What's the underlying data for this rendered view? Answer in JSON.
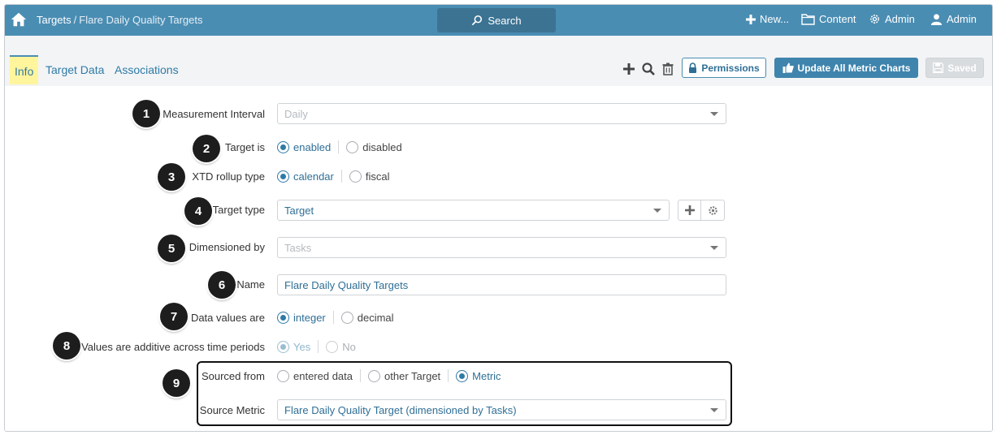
{
  "header": {
    "breadcrumb_root": "Targets",
    "breadcrumb_sep": "/",
    "breadcrumb_current": "Flare Daily Quality Targets",
    "search_label": "Search",
    "new_label": "New...",
    "content_label": "Content",
    "admin_menu_label": "Admin",
    "user_label": "Admin"
  },
  "tabs": [
    {
      "label": "Info",
      "active": true
    },
    {
      "label": "Target Data",
      "active": false
    },
    {
      "label": "Associations",
      "active": false
    }
  ],
  "toolbar": {
    "permissions_label": "Permissions",
    "update_label": "Update All Metric Charts",
    "saved_label": "Saved"
  },
  "form": {
    "measurement_interval": {
      "label": "Measurement Interval",
      "value": "Daily"
    },
    "target_is": {
      "label": "Target is",
      "options": [
        "enabled",
        "disabled"
      ],
      "selected": "enabled"
    },
    "xtd_rollup": {
      "label": "XTD rollup type",
      "options": [
        "calendar",
        "fiscal"
      ],
      "selected": "calendar"
    },
    "target_type": {
      "label": "Target type",
      "value": "Target"
    },
    "dimensioned_by": {
      "label": "Dimensioned by",
      "value": "Tasks"
    },
    "name": {
      "label": "Name",
      "value": "Flare Daily Quality Targets"
    },
    "data_values": {
      "label": "Data values are",
      "options": [
        "integer",
        "decimal"
      ],
      "selected": "integer"
    },
    "additive": {
      "label": "Values are additive across time periods",
      "options": [
        "Yes",
        "No"
      ],
      "selected": "Yes"
    },
    "sourced_from": {
      "label": "Sourced from",
      "options": [
        "entered data",
        "other Target",
        "Metric"
      ],
      "selected": "Metric"
    },
    "source_metric": {
      "label": "Source Metric",
      "value": "Flare Daily Quality Target (dimensioned by Tasks)"
    }
  },
  "callouts": [
    "1",
    "2",
    "3",
    "4",
    "5",
    "6",
    "7",
    "8",
    "9"
  ],
  "colors": {
    "header_bg": "#4a8db3",
    "search_bg": "#3c7393",
    "accent": "#2f7aa6",
    "active_tab_bg": "#fff59d"
  }
}
